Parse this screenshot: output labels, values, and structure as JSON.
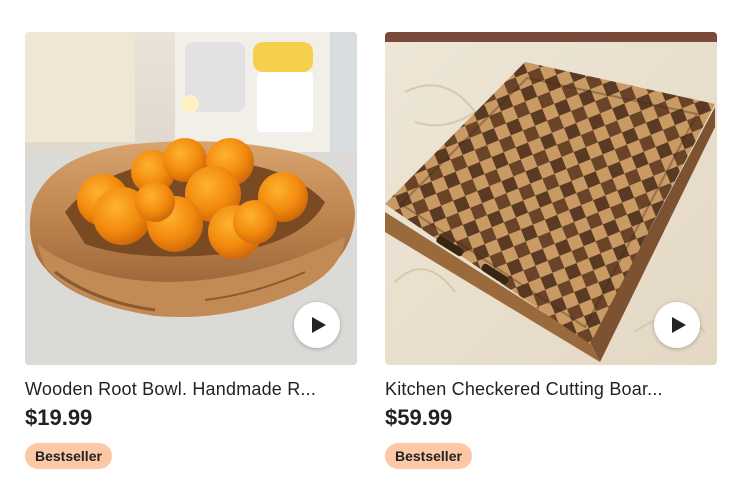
{
  "listings": [
    {
      "title": "Wooden Root Bowl. Handmade R...",
      "price": "$19.99",
      "badge": "Bestseller",
      "image_alt": "Wooden root bowl filled with oranges",
      "play_icon": "play-icon"
    },
    {
      "title": "Kitchen Checkered Cutting Boar...",
      "price": "$59.99",
      "badge": "Bestseller",
      "image_alt": "Checkered end-grain wooden cutting board",
      "play_icon": "play-icon"
    }
  ],
  "colors": {
    "badge_bg": "#fcc8a6",
    "text": "#222222"
  }
}
